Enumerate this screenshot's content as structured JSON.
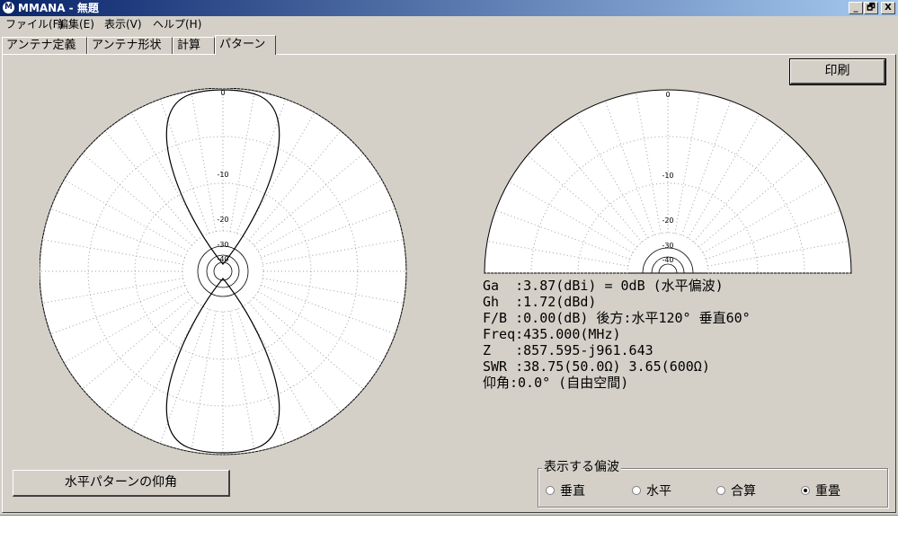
{
  "window": {
    "app_icon_glyph": "M",
    "title": "MMANA - 無題",
    "buttons": {
      "minimize": "_",
      "restore": "🗗",
      "close": "X"
    }
  },
  "menu": {
    "items": [
      "ファイル(F)",
      "編集(E)",
      "表示(V)",
      "ヘルプ(H)"
    ]
  },
  "tabs": [
    {
      "label": "アンテナ定義",
      "active": false
    },
    {
      "label": "アンテナ形状",
      "active": false
    },
    {
      "label": "計算",
      "active": false
    },
    {
      "label": "パターン",
      "active": true
    }
  ],
  "buttons": {
    "print": "印刷",
    "elevation": "水平パターンの仰角"
  },
  "plots": {
    "ring_labels": [
      "0",
      "-10",
      "-20",
      "-30",
      "-40"
    ]
  },
  "info": {
    "ga": "Ga  :3.87(dBi) = 0dB (水平偏波)",
    "gh": "Gh  :1.72(dBd)",
    "fb": "F/B :0.00(dB) 後方:水平120° 垂直60°",
    "freq": "Freq:435.000(MHz)",
    "z": "Z   :857.595-j961.643",
    "swr": "SWR :38.75(50.0Ω) 3.65(600Ω)",
    "elev": "仰角:0.0° (自由空間)"
  },
  "polarization": {
    "legend": "表示する偏波",
    "options": [
      {
        "label": "垂直",
        "checked": false
      },
      {
        "label": "水平",
        "checked": false
      },
      {
        "label": "合算",
        "checked": false
      },
      {
        "label": "重畳",
        "checked": true
      }
    ]
  }
}
